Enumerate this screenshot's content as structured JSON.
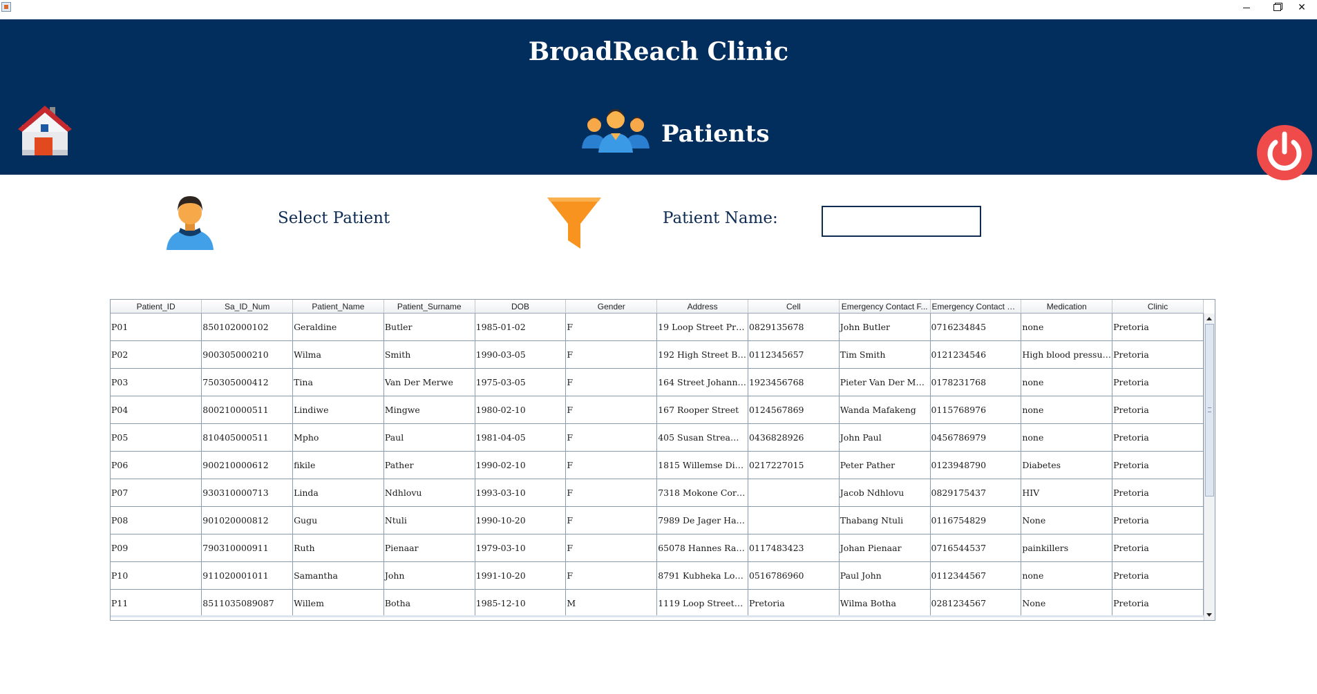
{
  "window": {
    "minimize_glyph": "—",
    "close_glyph": "✕"
  },
  "header": {
    "app_title": "BroadReach Clinic",
    "section_title": "Patients",
    "background_color": "#022e5e",
    "home_icon": "home-icon",
    "power_icon": "power-icon",
    "group_icon": "patients-group-icon"
  },
  "filter": {
    "select_label": "Select Patient",
    "name_label": "Patient Name:",
    "name_value": "",
    "person_icon": "person-icon",
    "funnel_icon": "funnel-icon",
    "funnel_color": "#f7931e"
  },
  "table": {
    "columns": [
      "Patient_ID",
      "Sa_ID_Num",
      "Patient_Name",
      "Patient_Surname",
      "DOB",
      "Gender",
      "Address",
      "Cell",
      "Emergency Contact F...",
      "Emergency Contact C...",
      "Medication",
      "Clinic"
    ],
    "rows": [
      [
        "P01",
        "850102000102",
        "Geraldine",
        "Butler",
        "1985-01-02",
        "F",
        "19 Loop Street Pret...",
        "0829135678",
        "John Butler",
        "0716234845",
        "none",
        "Pretoria"
      ],
      [
        "P02",
        "900305000210",
        "Wilma",
        "Smith",
        "1990-03-05",
        "F",
        "192 High Street Bro...",
        "0112345657",
        "Tim Smith",
        "0121234546",
        "High blood pressure",
        "Pretoria"
      ],
      [
        "P03",
        "750305000412",
        "Tina",
        "Van Der Merwe",
        "1975-03-05",
        "F",
        "164 Street Johannes...",
        "1923456768",
        "Pieter Van Der Merwe",
        "0178231768",
        "none",
        "Pretoria"
      ],
      [
        "P04",
        "800210000511",
        "Lindiwe",
        "Mingwe",
        "1980-02-10",
        "F",
        "167 Rooper Street",
        "0124567869",
        "Wanda Mafakeng",
        "0115768976",
        "none",
        "Pretoria"
      ],
      [
        "P05",
        "810405000511",
        "Mpho",
        " Paul",
        "1981-04-05",
        "F",
        "405 Susan Stream E...",
        "0436828926",
        "John Paul",
        "0456786979",
        "none",
        "Pretoria"
      ],
      [
        "P06",
        "900210000612",
        "fikile",
        "Pather",
        "1990-02-10",
        "F",
        "1815 Willemse Divi...",
        "0217227015",
        "Peter Pather",
        "0123948790",
        "Diabetes",
        "Pretoria"
      ],
      [
        "P07",
        "930310000713",
        "Linda",
        "Ndhlovu",
        "1993-03-10",
        "F",
        "7318 Mokone Corne...",
        "",
        "Jacob Ndhlovu",
        "0829175437",
        "HIV",
        "Pretoria"
      ],
      [
        "P08",
        "901020000812",
        "Gugu",
        " Ntuli",
        "1990-10-20",
        "F",
        "7989 De Jager Harb...",
        "",
        "Thabang  Ntuli",
        "0116754829",
        "None",
        "Pretoria"
      ],
      [
        "P09",
        "790310000911",
        "Ruth",
        " Pienaar",
        "1979-03-10",
        "F",
        "65078 Hannes Ramp...",
        "0117483423",
        "Johan  Pienaar",
        "0716544537",
        "painkillers",
        "Pretoria"
      ],
      [
        "P10",
        "911020001011",
        "Samantha",
        " John",
        "1991-10-20",
        "F",
        "8791 Kubheka Lodg...",
        "0516786960",
        "Paul John",
        "0112344567",
        "none",
        "Pretoria"
      ],
      [
        "P11",
        "8511035089087",
        "Willem",
        "Botha",
        "1985-12-10",
        "M",
        "1119 Loop StreetPr...",
        "Pretoria",
        "Wilma Botha",
        "0281234567",
        "None",
        "Pretoria"
      ]
    ]
  }
}
